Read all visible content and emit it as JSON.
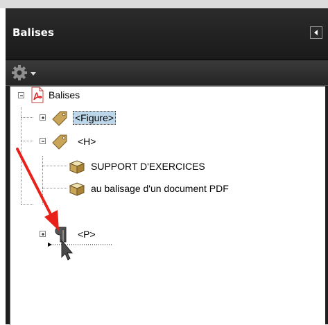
{
  "panel": {
    "title": "Balises"
  },
  "tree": {
    "root": {
      "label": "Balises",
      "expanded": true
    },
    "children": [
      {
        "label": "<Figure>",
        "selected": true,
        "expanded": false
      },
      {
        "label": "<H>",
        "expanded": true,
        "children": [
          {
            "label": "SUPPORT D'EXERCICES"
          },
          {
            "label": "au balisage d'un document PDF"
          }
        ]
      },
      {
        "label": "<P>",
        "expanded": false
      }
    ]
  },
  "annotation": {
    "arrow_color": "#e8211b"
  },
  "icons": {
    "options": "gear-icon",
    "collapse": "triangle-left-icon",
    "root": "pdf-icon",
    "tag": "tag-icon",
    "content": "content-box-icon",
    "paragraph": "pilcrow-icon"
  }
}
